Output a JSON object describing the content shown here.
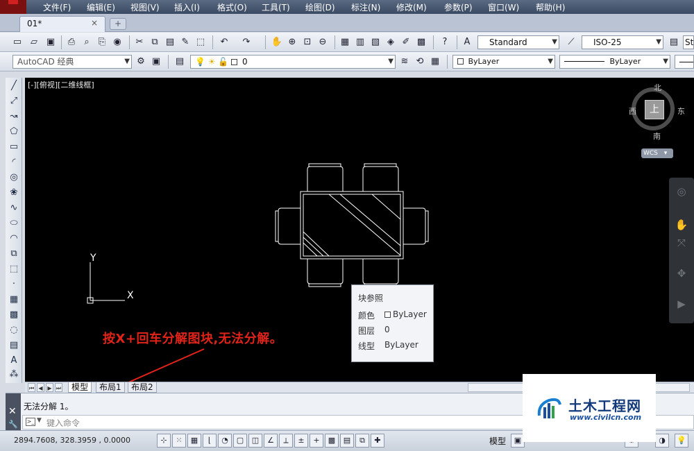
{
  "menubar": {
    "items": [
      "文件(F)",
      "编辑(E)",
      "视图(V)",
      "插入(I)",
      "格式(O)",
      "工具(T)",
      "绘图(D)",
      "标注(N)",
      "修改(M)",
      "参数(P)",
      "窗口(W)",
      "帮助(H)"
    ]
  },
  "document_tab": {
    "label": "01*",
    "close": "×",
    "new_tab": "+"
  },
  "toolbar1": {
    "text_style": "Standard",
    "dim_style": "ISO-25",
    "overflow_label": "St"
  },
  "toolbar2": {
    "workspace": "AutoCAD 经典",
    "layer": "0",
    "color": "ByLayer",
    "linetype": "ByLayer"
  },
  "viewport": {
    "label": "[-][俯视][二维线框]",
    "viewcube": {
      "north": "北",
      "west": "西",
      "east": "东",
      "south": "南",
      "face": "上"
    },
    "wcs": "WCS",
    "ucs_x": "X",
    "ucs_y": "Y"
  },
  "tooltip": {
    "title": "块参照",
    "rows": [
      {
        "label": "颜色",
        "value": "ByLayer",
        "swatch": true
      },
      {
        "label": "图层",
        "value": "0"
      },
      {
        "label": "线型",
        "value": "ByLayer"
      }
    ]
  },
  "annotation": "按X+回车分解图块,无法分解。",
  "layout_tabs": [
    "模型",
    "布局1",
    "布局2"
  ],
  "command": {
    "history": "无法分解 1。",
    "placeholder": "键入命令"
  },
  "statusbar": {
    "coordinates": "2894.7608, 328.3959 , 0.0000",
    "model_label": "模型"
  },
  "watermark": {
    "title": "土木工程网",
    "url": "www.civilcn.com"
  },
  "colors": {
    "canvas": "#000000",
    "annotation": "#e2231a",
    "drawing_lines": "#ffffff",
    "menubar": "#3b4a63"
  }
}
